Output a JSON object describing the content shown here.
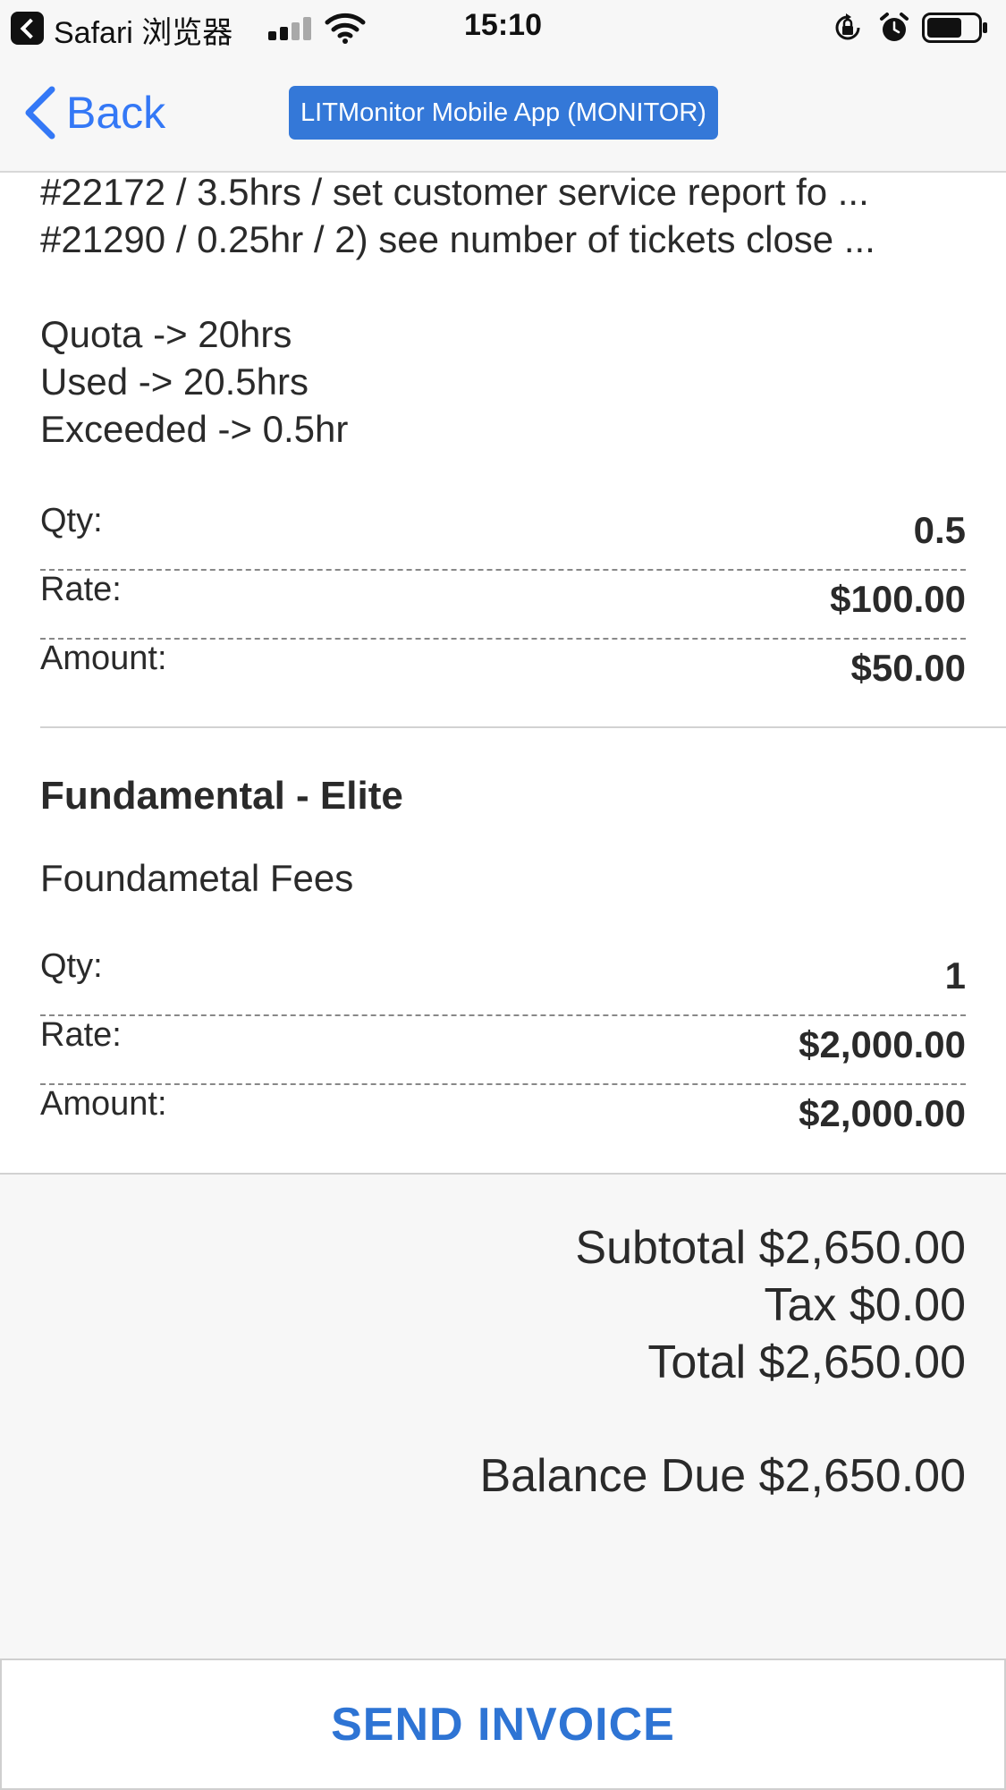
{
  "status_bar": {
    "app_name": "Safari 浏览器",
    "time": "15:10"
  },
  "nav": {
    "back_label": "Back",
    "title": "LITMonitor Mobile App (MONITOR)"
  },
  "notes": {
    "lines": [
      "#22172 / 3.5hrs / set customer service report fo ...",
      "#21290 / 0.25hr / 2) see number of tickets close ..."
    ],
    "summary": [
      "Quota -> 20hrs",
      "Used -> 20.5hrs",
      "Exceeded -> 0.5hr"
    ]
  },
  "line_items": [
    {
      "title": "",
      "description": "",
      "qty_label": "Qty:",
      "qty": "0.5",
      "rate_label": "Rate:",
      "rate": "$100.00",
      "amount_label": "Amount:",
      "amount": "$50.00"
    },
    {
      "title": "Fundamental - Elite",
      "description": "Foundametal Fees",
      "qty_label": "Qty:",
      "qty": "1",
      "rate_label": "Rate:",
      "rate": "$2,000.00",
      "amount_label": "Amount:",
      "amount": "$2,000.00"
    }
  ],
  "totals": {
    "subtotal": "Subtotal $2,650.00",
    "tax": "Tax $0.00",
    "total": "Total $2,650.00",
    "balance_due": "Balance Due $2,650.00"
  },
  "actions": {
    "send_invoice": "SEND INVOICE"
  },
  "colors": {
    "accent": "#3478f6",
    "pill": "#3478d8",
    "button_text": "#2e74d4"
  }
}
